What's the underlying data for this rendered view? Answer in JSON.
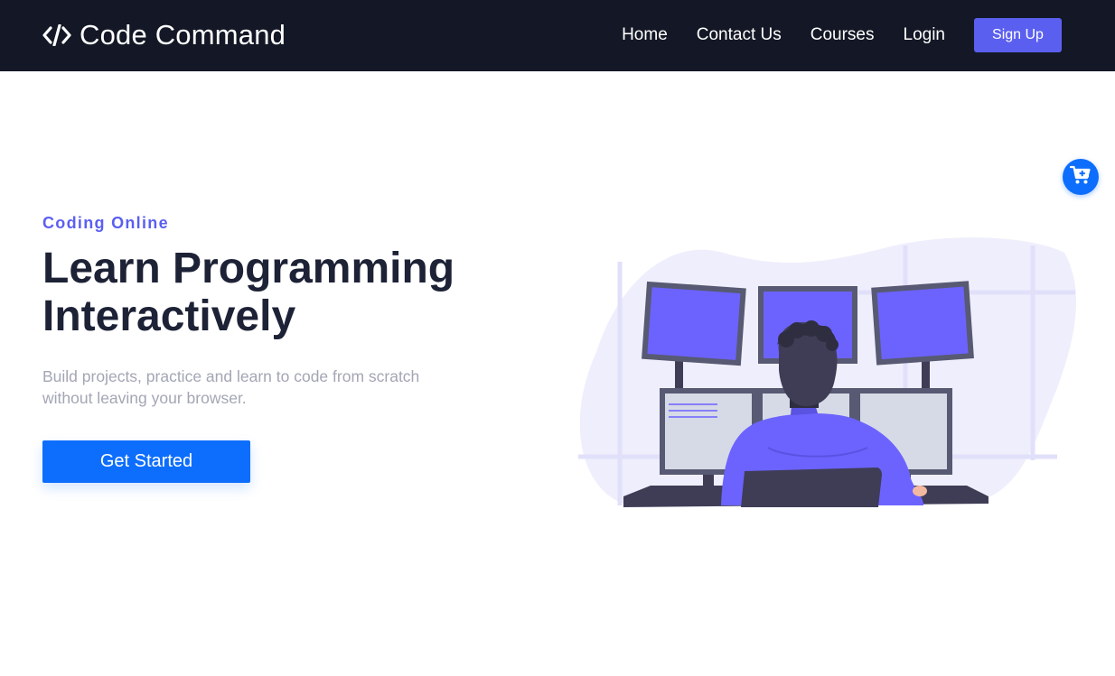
{
  "brand": {
    "name": "Code Command",
    "logo_icon": "code-brackets-icon"
  },
  "nav": {
    "links": [
      "Home",
      "Contact Us",
      "Courses",
      "Login"
    ],
    "signup_label": "Sign Up"
  },
  "hero": {
    "eyebrow": "Coding Online",
    "headline_line1": "Learn Programming",
    "headline_line2": "Interactively",
    "description": "Build projects, practice and learn to code from scratch without leaving your browser.",
    "cta_label": "Get Started",
    "illustration": "programmer-at-monitors-illustration"
  },
  "cart": {
    "icon": "cart-plus-icon"
  },
  "colors": {
    "navbar_bg": "#141826",
    "accent": "#5b5ff0",
    "primary": "#0d6efd",
    "heading": "#1e2236",
    "muted": "#a3a6b4"
  }
}
